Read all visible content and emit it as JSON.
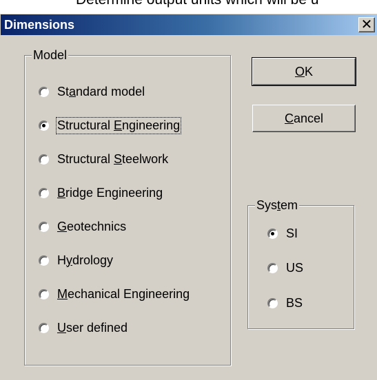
{
  "background_caption": "Determine output units which will be u",
  "window": {
    "title": "Dimensions",
    "close_glyph": "✕"
  },
  "model_group": {
    "label": "Model",
    "options": [
      {
        "before": "St",
        "accel": "a",
        "after": "ndard model",
        "checked": false
      },
      {
        "before": "Structural ",
        "accel": "E",
        "after": "ngineering",
        "checked": true
      },
      {
        "before": "Structural ",
        "accel": "S",
        "after": "teelwork",
        "checked": false
      },
      {
        "before": "",
        "accel": "B",
        "after": "ridge Engineering",
        "checked": false
      },
      {
        "before": "",
        "accel": "G",
        "after": "eotechnics",
        "checked": false
      },
      {
        "before": "H",
        "accel": "y",
        "after": "drology",
        "checked": false
      },
      {
        "before": "",
        "accel": "M",
        "after": "echanical Engineering",
        "checked": false
      },
      {
        "before": "",
        "accel": "U",
        "after": "ser defined",
        "checked": false
      }
    ]
  },
  "system_group": {
    "label_before": "Sys",
    "label_accel": "t",
    "label_after": "em",
    "options": [
      {
        "label": "SI",
        "checked": true
      },
      {
        "label": "US",
        "checked": false
      },
      {
        "label": "BS",
        "checked": false
      }
    ]
  },
  "buttons": {
    "ok": {
      "accel": "O",
      "rest": "K"
    },
    "cancel": {
      "accel": "C",
      "rest": "ancel"
    }
  }
}
